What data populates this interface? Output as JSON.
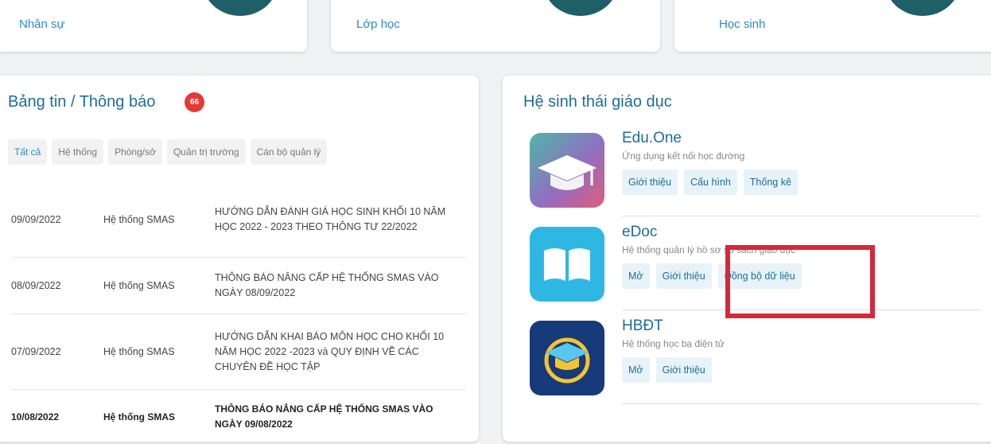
{
  "stats": {
    "staff_label": "Nhân sự",
    "class_label": "Lớp học",
    "student_label": "Học sinh"
  },
  "news": {
    "title": "Bảng tin / Thông báo",
    "badge_count": "66",
    "tabs": [
      "Tất cả",
      "Hệ thống",
      "Phòng/sở",
      "Quản trị trường",
      "Cán bộ quản lý"
    ],
    "rows": [
      {
        "date": "09/09/2022",
        "source": "Hệ thống SMAS",
        "title": "HƯỚNG DẪN ĐÁNH GIÁ HỌC SINH KHỐI 10 NĂM HỌC 2022 - 2023 THEO THÔNG TƯ 22/2022"
      },
      {
        "date": "08/09/2022",
        "source": "Hệ thống SMAS",
        "title": "THÔNG BÁO NÂNG CẤP HỆ THỐNG SMAS VÀO NGÀY 08/09/2022"
      },
      {
        "date": "07/09/2022",
        "source": "Hệ thống SMAS",
        "title": "HƯỚNG DẪN KHAI BÁO MÔN HỌC CHO KHỐI 10 NĂM HỌC 2022 -2023 và QUY ĐỊNH VỀ CÁC CHUYÊN ĐỀ HỌC TẬP"
      },
      {
        "date": "10/08/2022",
        "source": "Hệ thống SMAS",
        "title": "THÔNG BÁO NÂNG CẤP HỆ THỐNG SMAS VÀO NGÀY 09/08/2022"
      }
    ]
  },
  "ecosystem": {
    "title": "Hệ sinh thái giáo dục",
    "apps": [
      {
        "name": "Edu.One",
        "desc": "Ứng dụng kết nối học đường",
        "actions": [
          "Giới thiệu",
          "Cấu hình",
          "Thống kê"
        ],
        "icon": "graduation-cap-icon"
      },
      {
        "name": "eDoc",
        "desc": "Hệ thống quản lý hồ sơ sổ sách giáo dục",
        "actions": [
          "Mở",
          "Giới thiệu",
          "Đồng bộ dữ liệu"
        ],
        "icon": "open-book-icon"
      },
      {
        "name": "HBĐT",
        "desc": "Hệ thống học bạ điện tử",
        "actions": [
          "Mở",
          "Giới thiệu"
        ],
        "icon": "hbdt-logo-icon"
      }
    ]
  },
  "colors": {
    "accent": "#1e6e93",
    "link": "#2a8dc4",
    "badge": "#e53935",
    "highlight": "#d6283a",
    "stat_circle": "#1e5f68"
  }
}
